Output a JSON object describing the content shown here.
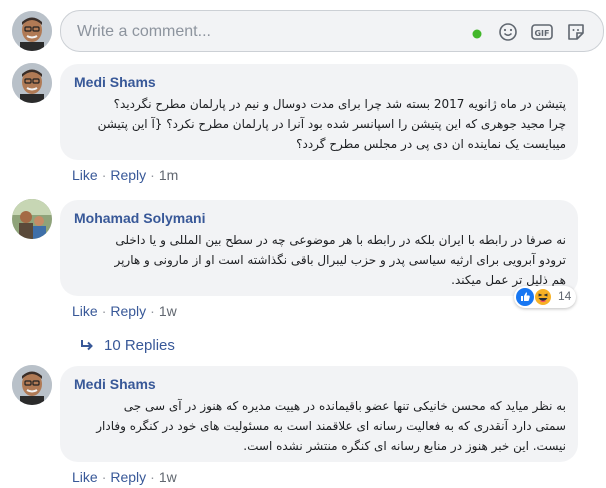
{
  "composer": {
    "placeholder": "Write a comment...",
    "icons": [
      "online-dot-icon",
      "emoji-icon",
      "gif-icon",
      "sticker-icon"
    ],
    "accent_color": "#42b72a"
  },
  "comments": [
    {
      "author": "Medi Shams",
      "lines": [
        "پتیشن در ماه ژانویه 2017 بسته شد چرا برای مدت دوسال و نیم در پارلمان مطرح نگردید؟",
        "چرا مجید جوهری که این پتیشن را اسپانسر شده بود آنرا در پارلمان مطرح نکرد؟ {آ این پتیشن",
        "میبایست یک نماینده ان دی پی در مجلس مطرح گردد؟"
      ],
      "actions": {
        "like": "Like",
        "reply": "Reply",
        "time": "1m"
      }
    },
    {
      "author": "Mohamad Solymani",
      "lines": [
        "نه صرفا در رابطه با ایران بلکه در رابطه با هر موضوعی چه در سطح بین المللی و یا داخلی",
        "ترودو آبرویی برای ارثیه سیاسی پدر و حزب لیبرال باقی نگذاشته است او از مارونی و هارپر",
        "هم ذلیل تر عمل میکند."
      ],
      "actions": {
        "like": "Like",
        "reply": "Reply",
        "time": "1w"
      },
      "reactions": {
        "count": "14",
        "types": [
          "like-icon",
          "haha-icon"
        ]
      },
      "replies_label": "10 Replies"
    },
    {
      "author": "Medi Shams",
      "lines": [
        "به نظر میاید که محسن خانیکی تنها عضو باقیمانده در هییت مدیره که هنوز در آی سی جی",
        "سمتی دارد آنقدری که به فعالیت رسانه ای علاقمند است به مسئولیت های خود در کنگره وفادار",
        "نیست. این خبر هنوز در منابع رسانه ای کنگره منتشر نشده است."
      ],
      "actions": {
        "like": "Like",
        "reply": "Reply",
        "time": "1w"
      }
    }
  ],
  "colors": {
    "link": "#385898",
    "bubble": "#f2f3f5",
    "like_blue": "#1877f2",
    "haha_yellow": "#f7b125"
  }
}
